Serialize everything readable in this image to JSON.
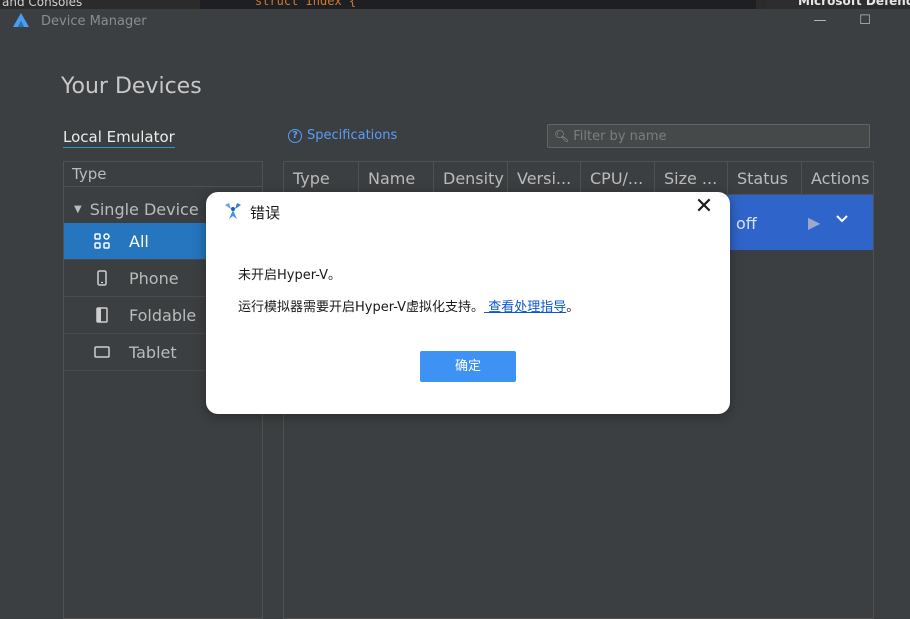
{
  "background": {
    "left_text": "and Consoles",
    "code_text": "struct Index {",
    "right_app_text": "Microsoft Defender"
  },
  "window": {
    "title": "Device Manager",
    "minimize": "—",
    "maximize": "☐",
    "close": "✕"
  },
  "heading": "Your Devices",
  "tabs": {
    "local": "Local Emulator"
  },
  "specifications": {
    "icon": "?",
    "label": "Specifications"
  },
  "filter": {
    "placeholder": "Filter by name"
  },
  "type_panel": {
    "header": "Type",
    "group": "Single Device",
    "items": [
      {
        "label": "All",
        "icon": "grid-icon",
        "selected": true
      },
      {
        "label": "Phone",
        "icon": "phone-icon",
        "selected": false
      },
      {
        "label": "Foldable",
        "icon": "foldable-icon",
        "selected": false
      },
      {
        "label": "Tablet",
        "icon": "tablet-icon",
        "selected": false
      }
    ]
  },
  "table": {
    "columns": [
      "Type",
      "Name",
      "Density",
      "Versi...",
      "CPU/...",
      "Size ...",
      "Status",
      "Actions"
    ],
    "rows": [
      {
        "status": "off"
      }
    ]
  },
  "dialog": {
    "title": "错误",
    "close": "✕",
    "message1": "未开启Hyper-V。",
    "message2_prefix": "运行模拟器需要开启Hyper-V虚拟化支持。",
    "message2_link": " 查看处理指导",
    "message2_suffix": "。",
    "ok_label": "确定"
  },
  "colors": {
    "selection": "#2675bf",
    "row_highlight": "#2f65ca",
    "link": "#589df6",
    "ok_button": "#3e92f4"
  }
}
